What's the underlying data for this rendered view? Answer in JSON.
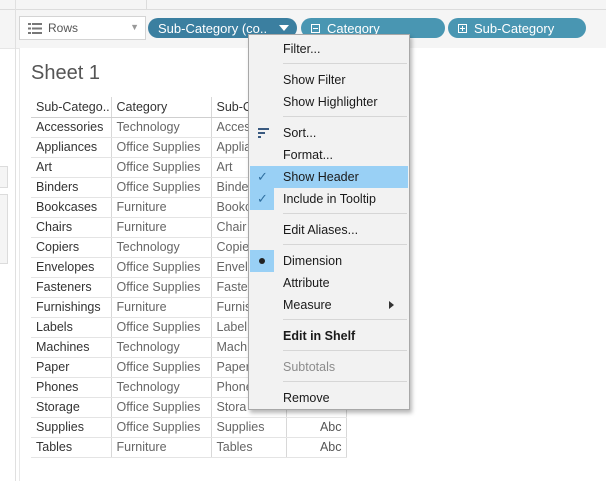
{
  "shelf": {
    "rows_label": "Rows",
    "pills": [
      {
        "label": "Sub-Category (co..",
        "icon": "none",
        "has_dropdown": true,
        "active": true
      },
      {
        "label": "Category",
        "icon": "minus-box-icon",
        "has_dropdown": false,
        "active": false
      },
      {
        "label": "Sub-Category",
        "icon": "plus-box-icon",
        "has_dropdown": false,
        "active": false
      }
    ]
  },
  "sheet": {
    "title": "Sheet 1",
    "headers": [
      "Sub-Catego..",
      "Category",
      "Sub-C"
    ],
    "rows": [
      {
        "sub": "Accessories",
        "cat": "Technology",
        "sub2": "Acces",
        "abc": ""
      },
      {
        "sub": "Appliances",
        "cat": "Office Supplies",
        "sub2": "Applia",
        "abc": ""
      },
      {
        "sub": "Art",
        "cat": "Office Supplies",
        "sub2": "Art",
        "abc": ""
      },
      {
        "sub": "Binders",
        "cat": "Office Supplies",
        "sub2": "Binde",
        "abc": ""
      },
      {
        "sub": "Bookcases",
        "cat": "Furniture",
        "sub2": "Bookc",
        "abc": ""
      },
      {
        "sub": "Chairs",
        "cat": "Furniture",
        "sub2": "Chair",
        "abc": ""
      },
      {
        "sub": "Copiers",
        "cat": "Technology",
        "sub2": "Copie",
        "abc": ""
      },
      {
        "sub": "Envelopes",
        "cat": "Office Supplies",
        "sub2": "Envel",
        "abc": ""
      },
      {
        "sub": "Fasteners",
        "cat": "Office Supplies",
        "sub2": "Faste",
        "abc": ""
      },
      {
        "sub": "Furnishings",
        "cat": "Furniture",
        "sub2": "Furnis",
        "abc": ""
      },
      {
        "sub": "Labels",
        "cat": "Office Supplies",
        "sub2": "Label",
        "abc": ""
      },
      {
        "sub": "Machines",
        "cat": "Technology",
        "sub2": "Mach",
        "abc": ""
      },
      {
        "sub": "Paper",
        "cat": "Office Supplies",
        "sub2": "Paper",
        "abc": ""
      },
      {
        "sub": "Phones",
        "cat": "Technology",
        "sub2": "Phone",
        "abc": ""
      },
      {
        "sub": "Storage",
        "cat": "Office Supplies",
        "sub2": "Stora",
        "abc": ""
      },
      {
        "sub": "Supplies",
        "cat": "Office Supplies",
        "sub2": "Supplies",
        "abc": "Abc"
      },
      {
        "sub": "Tables",
        "cat": "Furniture",
        "sub2": "Tables",
        "abc": "Abc"
      }
    ]
  },
  "menu": {
    "items": [
      {
        "label": "Filter..."
      },
      {
        "label": "Show Filter"
      },
      {
        "label": "Show Highlighter"
      },
      {
        "label": "Sort...",
        "icon": "sort-icon"
      },
      {
        "label": "Format..."
      },
      {
        "label": "Show Header",
        "checked": true,
        "highlighted": true
      },
      {
        "label": "Include in Tooltip",
        "checked": true
      },
      {
        "label": "Edit Aliases..."
      },
      {
        "label": "Dimension",
        "selected": true
      },
      {
        "label": "Attribute"
      },
      {
        "label": "Measure",
        "submenu": true
      },
      {
        "label": "Edit in Shelf",
        "bold": true
      },
      {
        "label": "Subtotals",
        "disabled": true
      },
      {
        "label": "Remove"
      }
    ]
  },
  "colors": {
    "pill": "#4996b2",
    "pill_active": "#3b7fa0",
    "menu_highlight": "#99d0f5",
    "check": "#2f6fa0"
  }
}
